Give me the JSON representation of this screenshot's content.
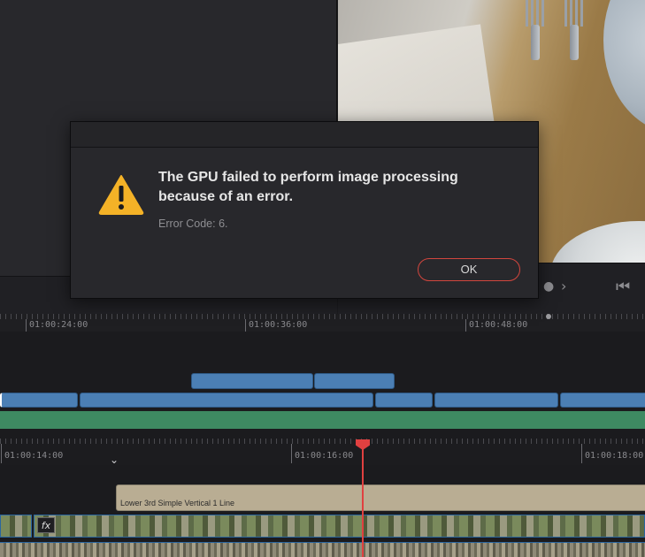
{
  "dialog": {
    "heading": "The GPU failed to perform image processing because of an error.",
    "error_code": "Error Code: 6.",
    "ok_label": "OK",
    "icon": "warning-icon",
    "accent_color": "#d2463e"
  },
  "timeline": {
    "upper_ruler": [
      "01:00:24:00",
      "01:00:36:00",
      "01:00:48:00"
    ],
    "lower_ruler": [
      "01:00:14:00",
      "01:00:16:00",
      "01:00:18:00"
    ],
    "title_clip_label": "Lower 3rd Simple Vertical 1 Line",
    "fx_label": "fx",
    "playhead_color": "#e04040"
  },
  "colors": {
    "audio_clip": "#4b7fb4",
    "audio_track_green": "#3e8a62",
    "title_clip": "#b9ad93",
    "warning_yellow": "#f4b227"
  }
}
